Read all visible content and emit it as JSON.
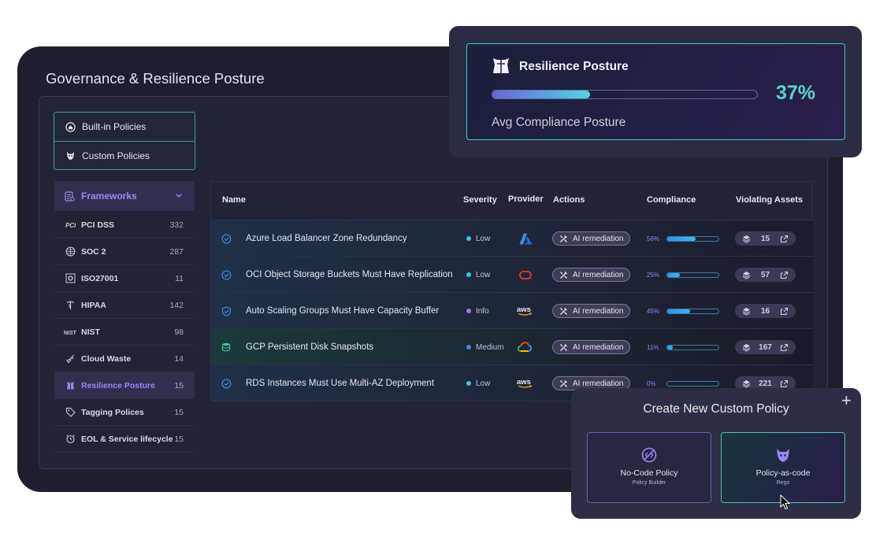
{
  "app": {
    "title": "Governance & Resilience Posture"
  },
  "policies": {
    "builtin_label": "Built-in Policies",
    "custom_label": "Custom Policies"
  },
  "frameworks": {
    "header": "Frameworks",
    "items": [
      {
        "label": "PCI DSS",
        "count": "332",
        "icon": "card-icon"
      },
      {
        "label": "SOC 2",
        "count": "287",
        "icon": "globe-icon"
      },
      {
        "label": "ISO27001",
        "count": "11",
        "icon": "gear-box-icon"
      },
      {
        "label": "HIPAA",
        "count": "142",
        "icon": "caduceus-icon"
      },
      {
        "label": "NIST",
        "count": "98",
        "icon": "nist-logo-icon"
      },
      {
        "label": "Cloud Waste",
        "count": "14",
        "icon": "broom-icon"
      },
      {
        "label": "Resilience Posture",
        "count": "15",
        "icon": "armor-icon",
        "active": true
      },
      {
        "label": "Tagging Polices",
        "count": "15",
        "icon": "tag-icon"
      },
      {
        "label": "EOL & Service lifecycle",
        "count": "15",
        "icon": "alarm-clock-icon"
      }
    ]
  },
  "table": {
    "headers": {
      "name": "Name",
      "severity": "Severity",
      "provider": "Provider",
      "actions": "Actions",
      "compliance": "Compliance",
      "violating": "Violating Assets"
    },
    "rows": [
      {
        "name": "Azure Load Balancer Zone Redundancy",
        "severity": "Low",
        "severity_color": "#3fc0e8",
        "provider": "azure",
        "action": "AI remediation",
        "compliance": "56%",
        "compliance_value": 56,
        "violating": "15"
      },
      {
        "name": "OCI Object Storage Buckets Must Have Replication",
        "severity": "Low",
        "severity_color": "#3fc0e8",
        "provider": "oracle",
        "action": "AI remediation",
        "compliance": "25%",
        "compliance_value": 25,
        "violating": "57"
      },
      {
        "name": "Auto Scaling Groups Must Have Capacity Buffer",
        "severity": "Info",
        "severity_color": "#9d7af0",
        "provider": "aws",
        "action": "AI remediation",
        "compliance": "45%",
        "compliance_value": 45,
        "violating": "16"
      },
      {
        "name": "GCP Persistent Disk Snapshots",
        "severity": "Medium",
        "severity_color": "#3f8fe8",
        "provider": "gcp",
        "action": "AI remediation",
        "compliance": "11%",
        "compliance_value": 11,
        "violating": "167"
      },
      {
        "name": "RDS Instances Must Use Multi-AZ Deployment",
        "severity": "Low",
        "severity_color": "#3fc0e8",
        "provider": "aws",
        "action": "AI remediation",
        "compliance": "0%",
        "compliance_value": 0,
        "violating": "221"
      }
    ]
  },
  "resilience": {
    "title": "Resilience Posture",
    "percent": "37%",
    "percent_value": 37,
    "subtitle": "Avg Compliance Posture"
  },
  "create_policy": {
    "title": "Create New Custom Policy",
    "plus": "+",
    "options": [
      {
        "title": "No-Code Policy",
        "subtitle": "Policy Builder"
      },
      {
        "title": "Policy-as-code",
        "subtitle": "Rego"
      }
    ]
  },
  "colors": {
    "accent_purple": "#9d86f5",
    "accent_teal": "#45c8c0",
    "window_bg": "#1e1e2f"
  }
}
